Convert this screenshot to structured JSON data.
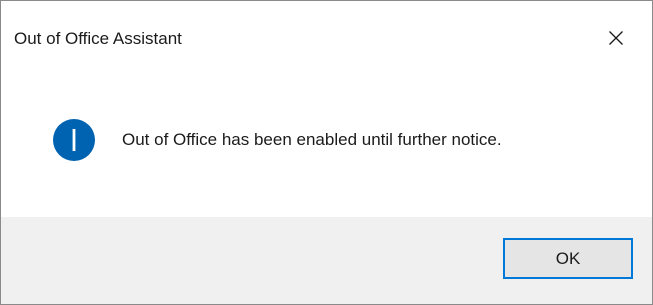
{
  "window": {
    "title": "Out of Office Assistant",
    "close_icon": "close-icon"
  },
  "message": {
    "icon": "info-icon",
    "text": "Out of Office has been enabled until further notice."
  },
  "buttons": {
    "ok_label": "OK"
  },
  "colors": {
    "accent": "#0078d7",
    "info_icon": "#0063b1",
    "footer_bg": "#f0f0f0",
    "button_bg": "#e5e5e5"
  }
}
